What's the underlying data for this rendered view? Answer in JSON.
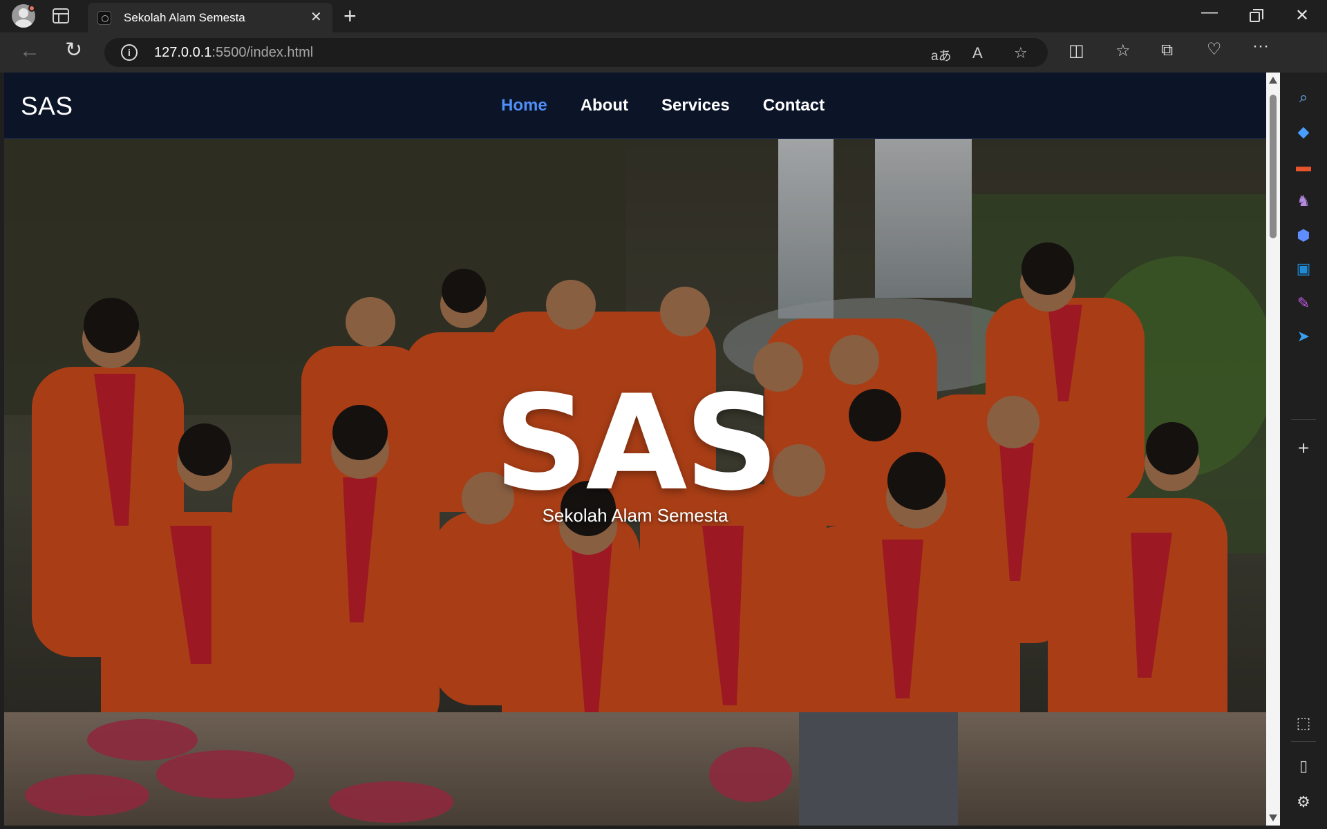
{
  "browser": {
    "tab_title": "Sekolah Alam Semesta",
    "tab_close": "✕",
    "new_tab": "+",
    "url_host": "127.0.0.1",
    "url_rest": ":5500/index.html",
    "window": {
      "minimize": "—",
      "close": "✕"
    }
  },
  "site": {
    "brand": "SAS",
    "menu": [
      {
        "label": "Home",
        "active": true
      },
      {
        "label": "About",
        "active": false
      },
      {
        "label": "Services",
        "active": false
      },
      {
        "label": "Contact",
        "active": false
      }
    ]
  },
  "hero": {
    "title": "SAS",
    "subtitle": "Sekolah Alam Semesta"
  },
  "colors": {
    "nav_bg": "#0c1428",
    "active_link": "#4f8ff7",
    "uniform_orange": "#e2521c",
    "scarf_red": "#c8202e"
  },
  "sidebar_icons": [
    "search-icon",
    "tag-icon",
    "toolbox-icon",
    "chess-icon",
    "copilot-icon",
    "outlook-icon",
    "designer-icon",
    "send-icon",
    "add-icon",
    "screenshot-icon",
    "panel-icon",
    "settings-icon"
  ]
}
